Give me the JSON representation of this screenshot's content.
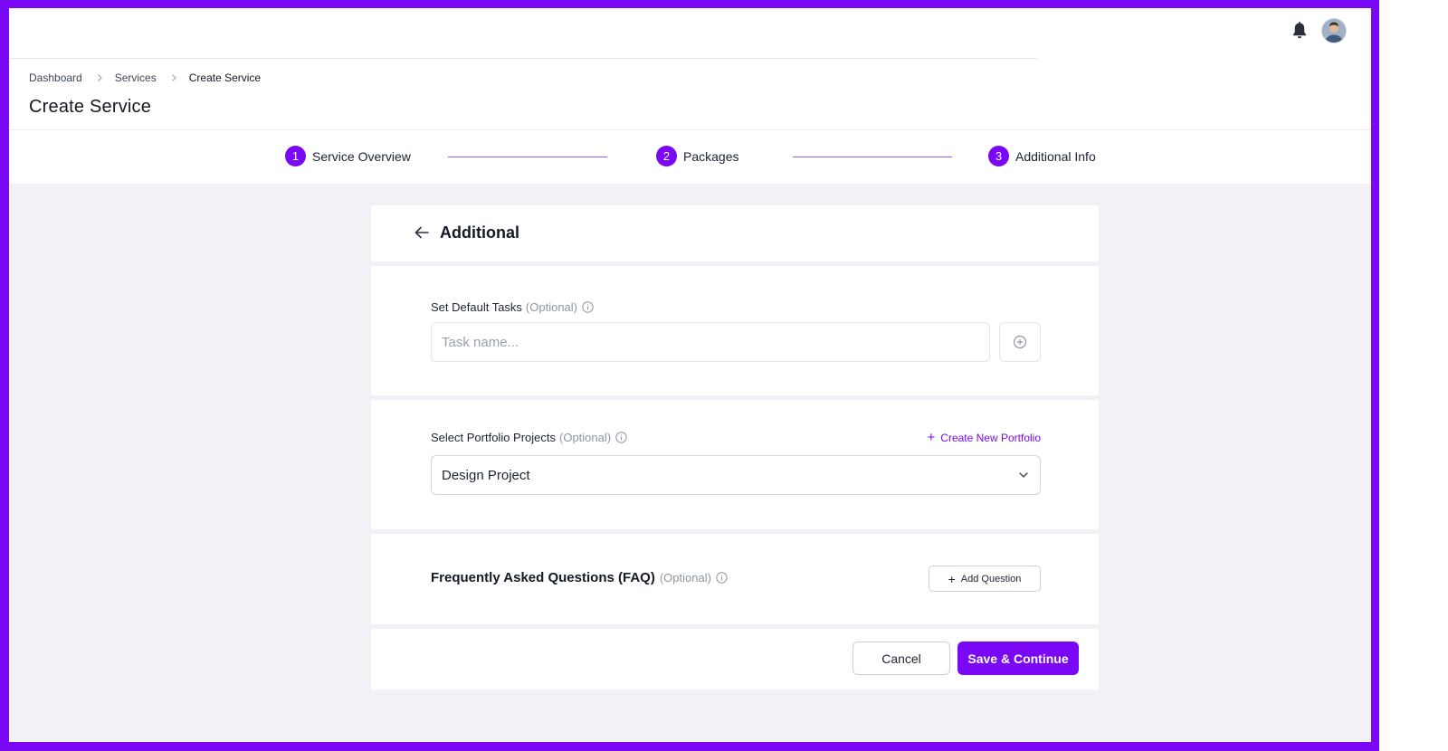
{
  "breadcrumb": {
    "items": [
      "Dashboard",
      "Services",
      "Create Service"
    ]
  },
  "page_title": "Create Service",
  "stepper": {
    "steps": [
      {
        "number": "1",
        "label": "Service Overview"
      },
      {
        "number": "2",
        "label": "Packages"
      },
      {
        "number": "3",
        "label": "Additional Info"
      }
    ]
  },
  "section_title": "Additional",
  "tasks": {
    "label": "Set Default Tasks",
    "optional": "(Optional)",
    "placeholder": "Task name...",
    "add_icon": "plus-circle-icon"
  },
  "portfolio": {
    "label": "Select Portfolio Projects",
    "optional": "(Optional)",
    "create_link": "Create New Portfolio",
    "selected": "Design Project"
  },
  "faq": {
    "title": "Frequently Asked Questions (FAQ)",
    "optional": "(Optional)",
    "add_button": "Add Question"
  },
  "actions": {
    "cancel": "Cancel",
    "save": "Save & Continue"
  },
  "colors": {
    "accent": "#7a08f5",
    "frame": "#7a08f5",
    "background": "#f1f2f6"
  },
  "icons": {
    "notifications": "bell-icon",
    "back": "arrow-left-icon",
    "info": "info-icon",
    "dropdown": "chevron-down-icon",
    "breadcrumb_separator": "chevron-right-icon"
  }
}
